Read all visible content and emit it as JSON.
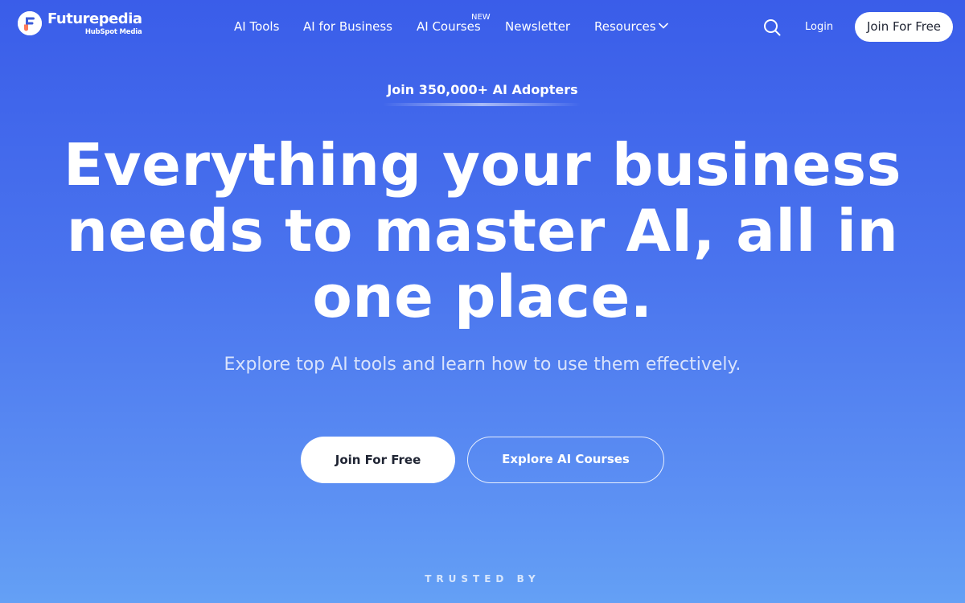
{
  "header": {
    "logo": {
      "name": "Futurepedia",
      "sub": "HubSpot Media"
    },
    "nav": [
      {
        "label": "AI Tools"
      },
      {
        "label": "AI for Business"
      },
      {
        "label": "AI Courses",
        "badge": "NEW"
      },
      {
        "label": "Newsletter"
      },
      {
        "label": "Resources",
        "icon": "chevron-down-icon"
      }
    ],
    "search_icon": "search-icon",
    "login_label": "Login",
    "join_label": "Join For Free"
  },
  "hero": {
    "eyebrow": "Join 350,000+ AI Adopters",
    "headline": "Everything your business needs to master AI, all in one place.",
    "subheading": "Explore top AI tools and learn how to use them effectively.",
    "cta_primary": "Join For Free",
    "cta_secondary": "Explore AI Courses"
  },
  "trusted_by": "TRUSTED BY",
  "colors": {
    "background_top": "#3a5de9",
    "background_bottom": "#64a0f5",
    "button_text": "#1f2433",
    "logo_accent": "#3b5bd9"
  }
}
